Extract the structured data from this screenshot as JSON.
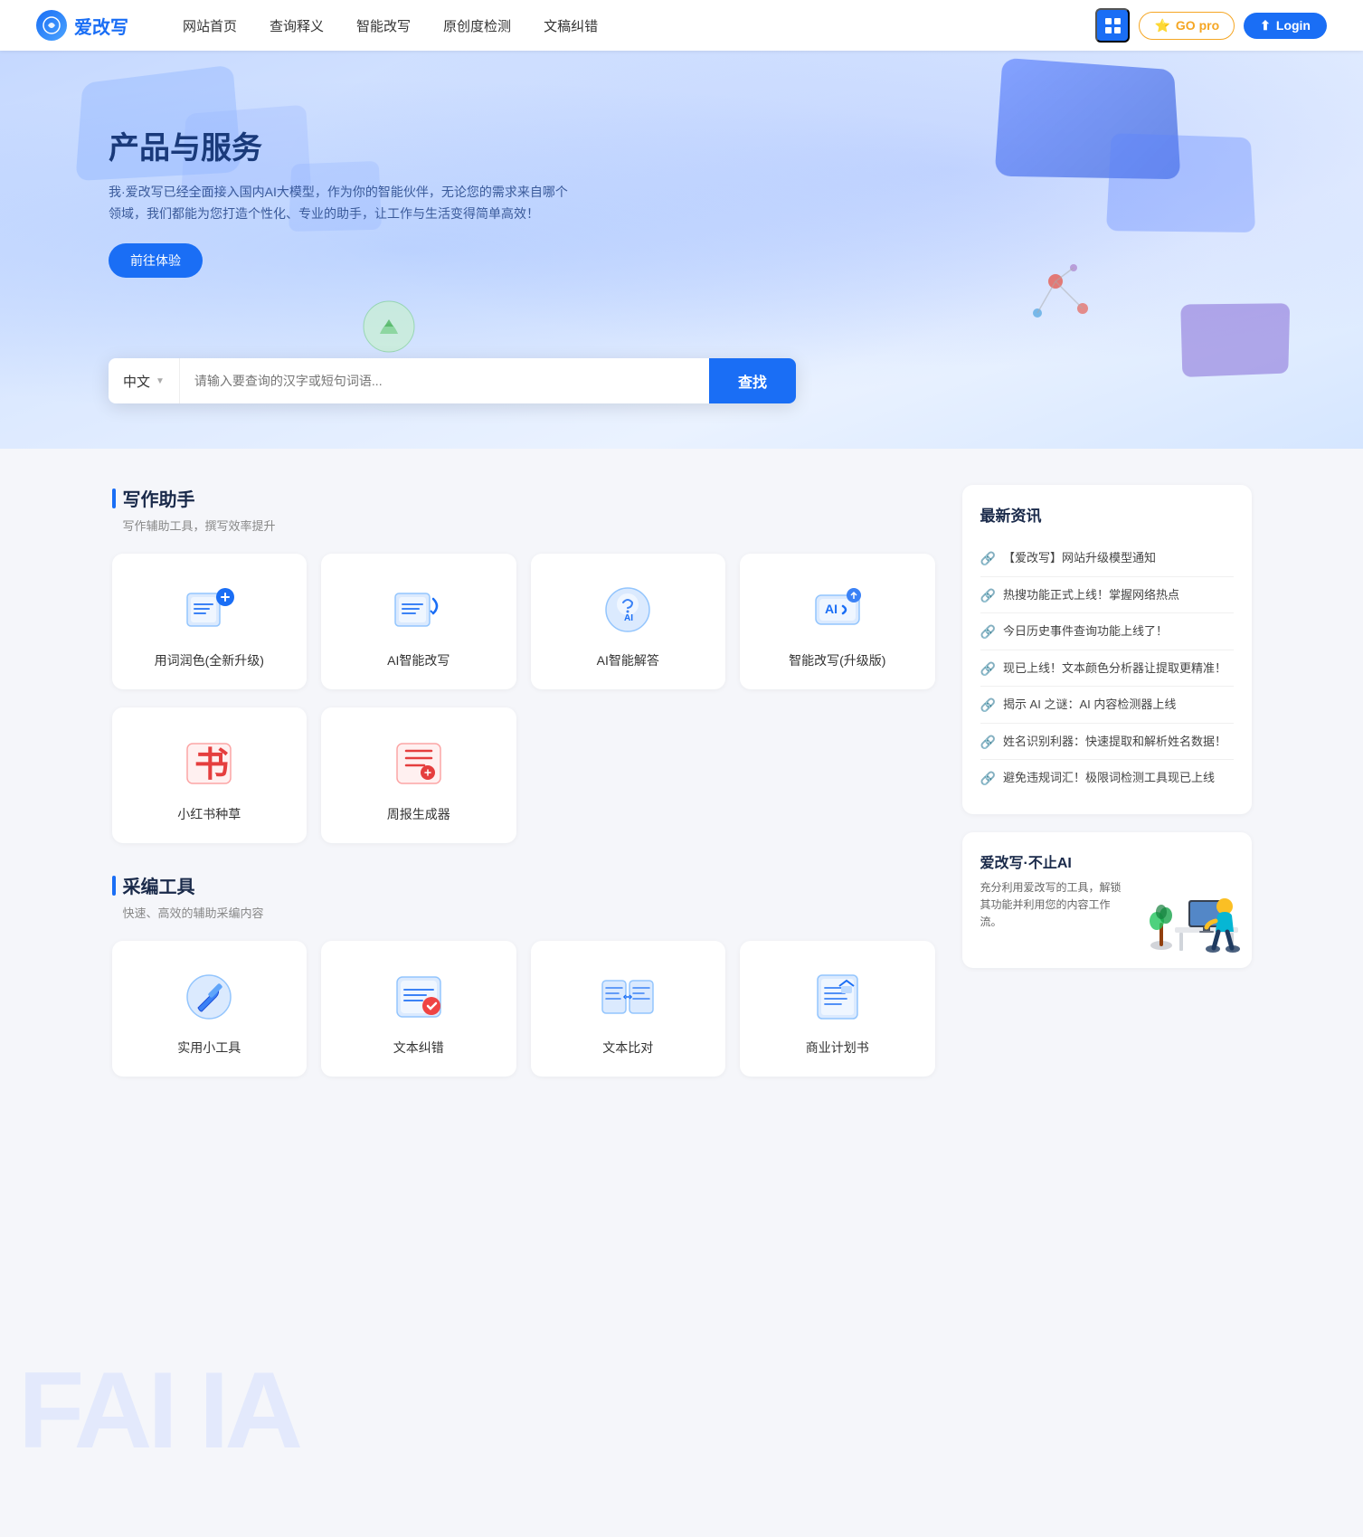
{
  "nav": {
    "logo_text": "爱改写",
    "links": [
      {
        "label": "网站首页"
      },
      {
        "label": "查询释义"
      },
      {
        "label": "智能改写"
      },
      {
        "label": "原创度检测"
      },
      {
        "label": "文稿纠错"
      }
    ],
    "btn_grid_title": "apps",
    "btn_go_pro": "GO pro",
    "btn_login": "Login"
  },
  "hero": {
    "title": "产品与服务",
    "subtitle": "我·爱改写已经全面接入国内AI大模型，作为你的智能伙伴，无论您的需求来自哪个领域，我们都能为您打造个性化、专业的助手，让工作与生活变得简单高效！",
    "cta_btn": "前往体验",
    "search": {
      "lang": "中文",
      "placeholder": "请输入要查询的汉字或短句词语...",
      "btn": "查找"
    }
  },
  "writing_tools": {
    "section_title": "写作助手",
    "section_subtitle": "写作辅助工具，撰写效率提升",
    "cards": [
      {
        "label": "用词润色(全新升级)",
        "icon_type": "word-polish"
      },
      {
        "label": "AI智能改写",
        "icon_type": "ai-rewrite"
      },
      {
        "label": "AI智能解答",
        "icon_type": "ai-answer"
      },
      {
        "label": "智能改写(升级版)",
        "icon_type": "smart-rewrite"
      },
      {
        "label": "小红书种草",
        "icon_type": "xiaohongshu"
      },
      {
        "label": "周报生成器",
        "icon_type": "weekly-report"
      }
    ]
  },
  "editing_tools": {
    "section_title": "采编工具",
    "section_subtitle": "快速、高效的辅助采编内容",
    "cards": [
      {
        "label": "实用小工具",
        "icon_type": "tools"
      },
      {
        "label": "文本纠错",
        "icon_type": "text-correct"
      },
      {
        "label": "文本比对",
        "icon_type": "text-compare"
      },
      {
        "label": "商业计划书",
        "icon_type": "business-plan"
      }
    ]
  },
  "news": {
    "title": "最新资讯",
    "items": [
      {
        "text": "【爱改写】网站升级模型通知"
      },
      {
        "text": "热搜功能正式上线！掌握网络热点"
      },
      {
        "text": "今日历史事件查询功能上线了！"
      },
      {
        "text": "现已上线！文本颜色分析器让提取更精准！"
      },
      {
        "text": "揭示 AI 之谜：AI 内容检测器上线"
      },
      {
        "text": "姓名识别利器：快速提取和解析姓名数据！"
      },
      {
        "text": "避免违规词汇！极限词检测工具现已上线"
      }
    ]
  },
  "promo": {
    "title": "爱改写·不止AI",
    "subtitle": "充分利用爱改写的工具，解锁其功能并利用您的内容工作流。"
  },
  "fai_ia": {
    "text": "FAI IA"
  }
}
